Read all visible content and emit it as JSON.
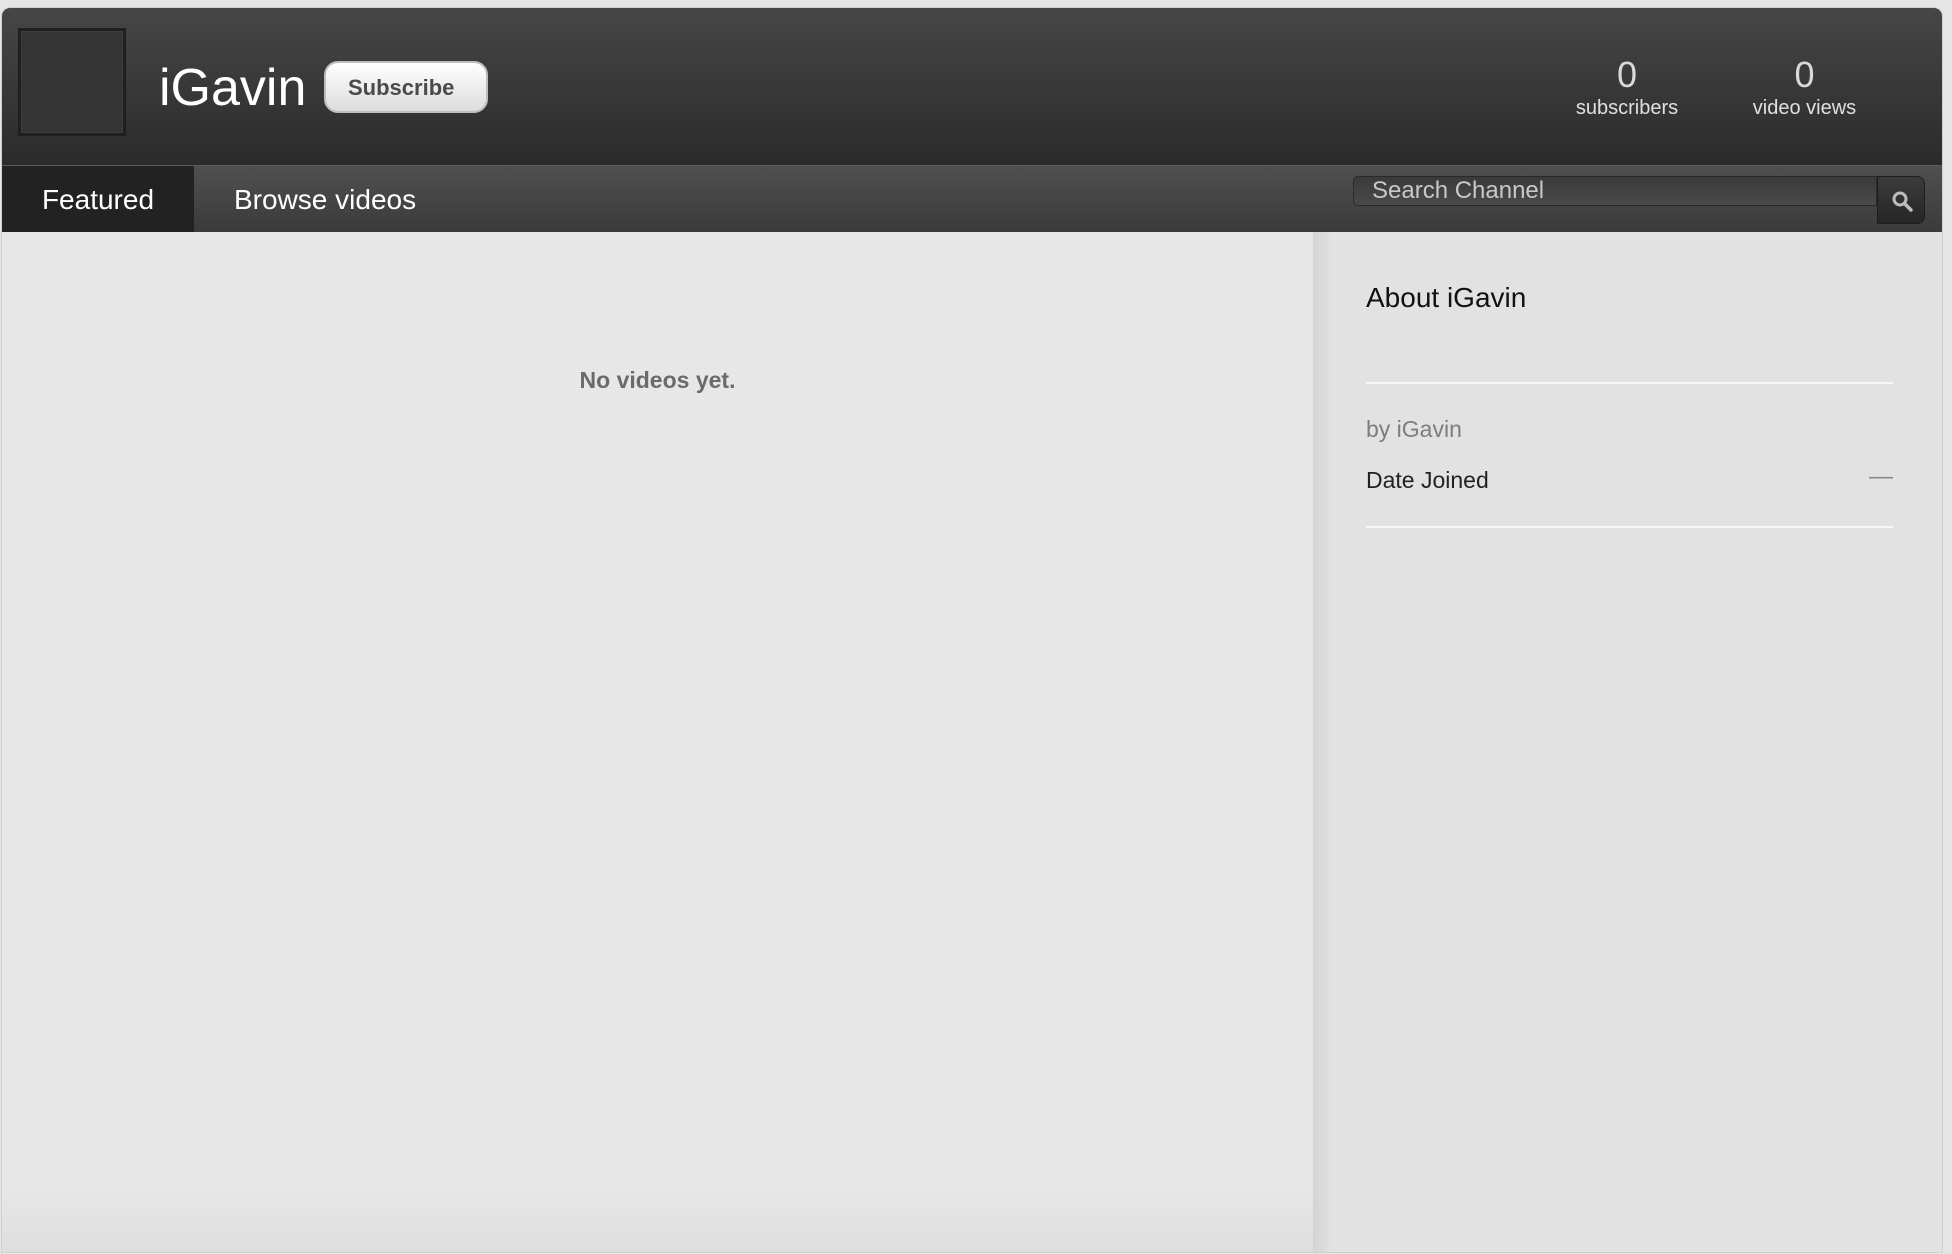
{
  "header": {
    "channel_name": "iGavin",
    "subscribe_label": "Subscribe",
    "stats": {
      "subscribers_count": "0",
      "subscribers_label": "subscribers",
      "views_count": "0",
      "views_label": "video views"
    }
  },
  "nav": {
    "tabs": [
      {
        "label": "Featured",
        "active": true
      },
      {
        "label": "Browse videos",
        "active": false
      }
    ],
    "search_placeholder": "Search Channel",
    "search_icon": "search-icon"
  },
  "main": {
    "empty_message": "No videos yet."
  },
  "sidebar": {
    "about_title": "About iGavin",
    "by_line": "by iGavin",
    "date_joined_label": "Date Joined",
    "date_joined_value": "—"
  },
  "colors": {
    "header_bg": "#2b2b2b",
    "nav_bg": "#4a4a4a",
    "active_tab_bg": "#222222",
    "page_bg": "#e7e7e7"
  }
}
